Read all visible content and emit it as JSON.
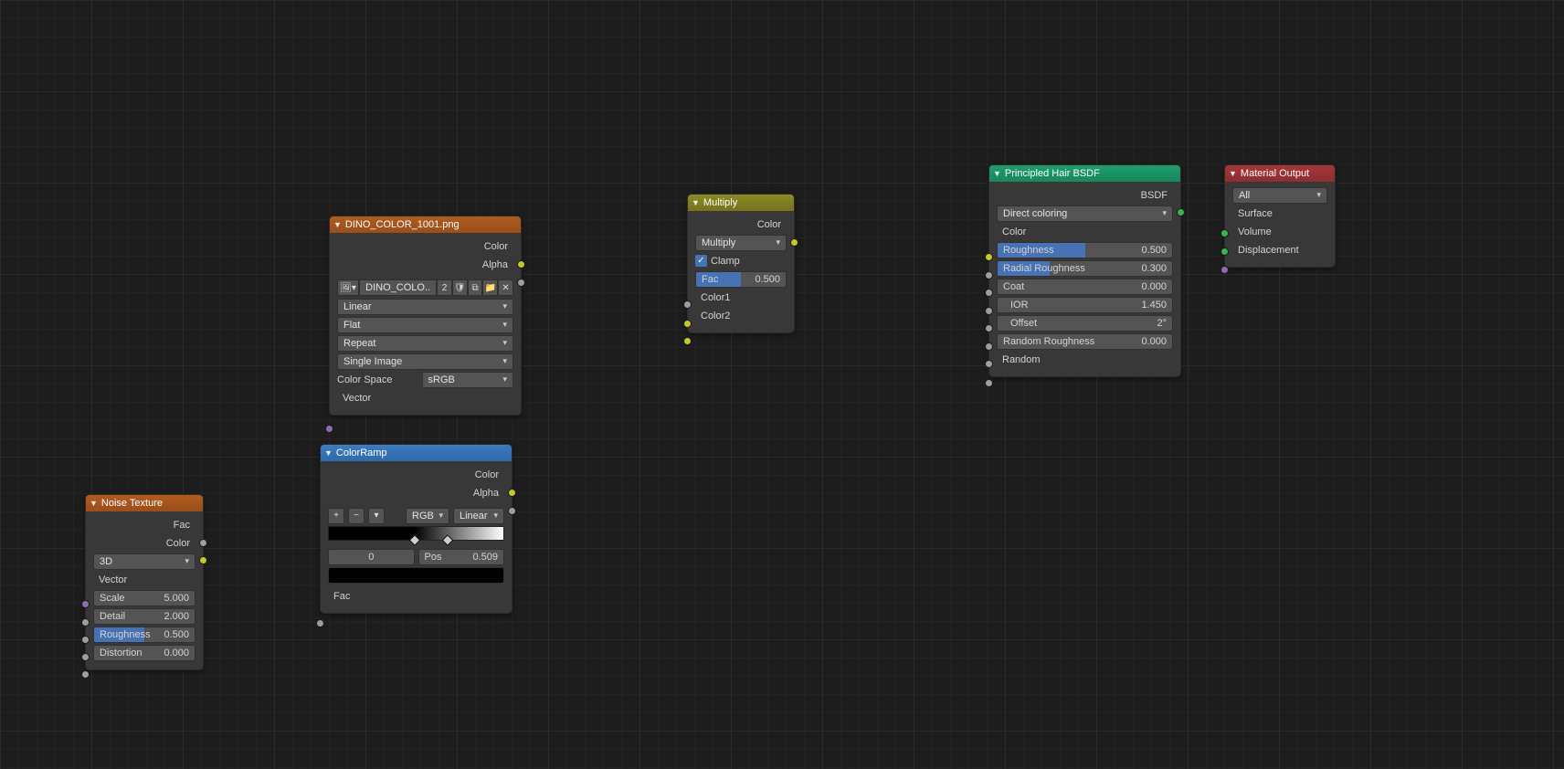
{
  "nodes": {
    "noise": {
      "title": "Noise Texture",
      "outputs": {
        "fac": "Fac",
        "color": "Color"
      },
      "dimensions": "3D",
      "inputs": {
        "vector": "Vector",
        "scale": {
          "label": "Scale",
          "value": "5.000",
          "fill": 0
        },
        "detail": {
          "label": "Detail",
          "value": "2.000",
          "fill": 0
        },
        "rough": {
          "label": "Roughness",
          "value": "0.500",
          "fill": 50
        },
        "dist": {
          "label": "Distortion",
          "value": "0.000",
          "fill": 0
        }
      }
    },
    "image": {
      "title": "DINO_COLOR_1001.png",
      "outputs": {
        "color": "Color",
        "alpha": "Alpha"
      },
      "file_short": "DINO_COLO..",
      "users": "2",
      "interp": "Linear",
      "proj": "Flat",
      "ext": "Repeat",
      "source": "Single Image",
      "colorspace_label": "Color Space",
      "colorspace": "sRGB",
      "input_vector": "Vector"
    },
    "colorramp": {
      "title": "ColorRamp",
      "outputs": {
        "color": "Color",
        "alpha": "Alpha"
      },
      "mode": "RGB",
      "interp": "Linear",
      "active_index": "0",
      "pos_label": "Pos",
      "pos_value": "0.509",
      "input_fac": "Fac",
      "stops": [
        0.49,
        0.68
      ]
    },
    "mix": {
      "title": "Multiply",
      "outputs": {
        "color": "Color"
      },
      "blend": "Multiply",
      "clamp": "Clamp",
      "fac": {
        "label": "Fac",
        "value": "0.500",
        "fill": 50
      },
      "color1": "Color1",
      "color2": "Color2"
    },
    "hair": {
      "title": "Principled Hair BSDF",
      "outputs": {
        "bsdf": "BSDF"
      },
      "param": "Direct coloring",
      "inputs": {
        "color": "Color",
        "rough": {
          "label": "Roughness",
          "value": "0.500",
          "fill": 50
        },
        "rrough": {
          "label": "Radial Roughness",
          "value": "0.300",
          "fill": 30
        },
        "coat": {
          "label": "Coat",
          "value": "0.000",
          "fill": 0
        },
        "ior": {
          "label": "IOR",
          "value": "1.450"
        },
        "offset": {
          "label": "Offset",
          "value": "2°"
        },
        "randr": {
          "label": "Random Roughness",
          "value": "0.000",
          "fill": 0
        },
        "random": "Random"
      }
    },
    "output": {
      "title": "Material Output",
      "target": "All",
      "inputs": {
        "surface": "Surface",
        "volume": "Volume",
        "disp": "Displacement"
      }
    }
  }
}
